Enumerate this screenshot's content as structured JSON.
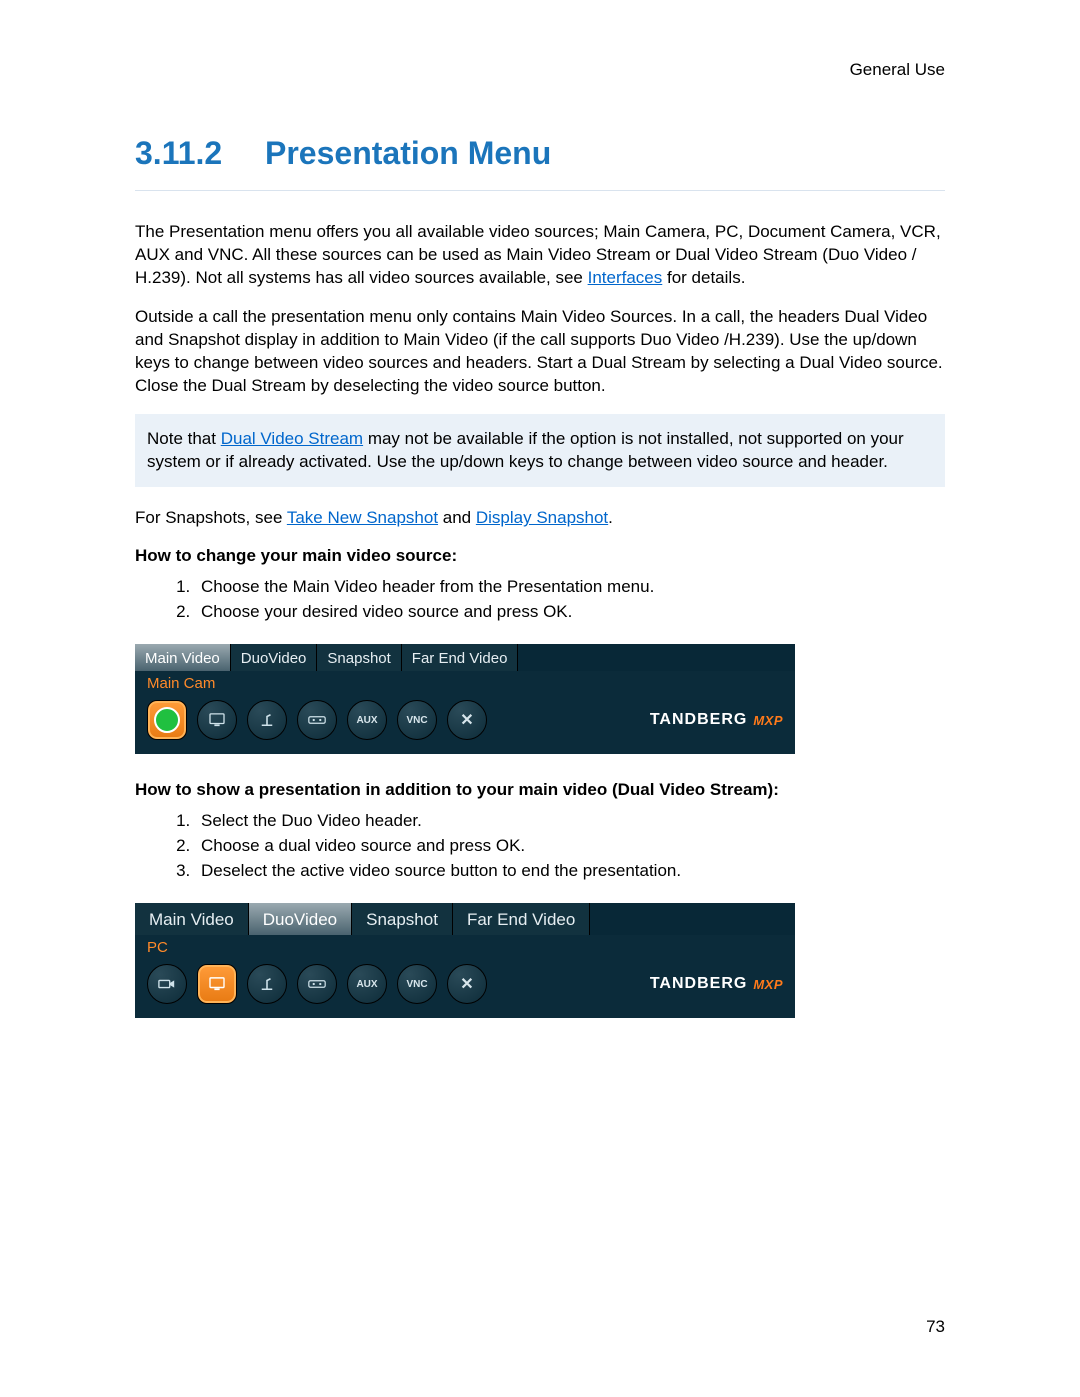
{
  "header": {
    "section": "General Use"
  },
  "heading": {
    "number": "3.11.2",
    "title": "Presentation Menu"
  },
  "para1_a": "The Presentation menu offers you all available video sources; Main Camera, PC, Document Camera, VCR, AUX and VNC. All these sources can be used as Main Video Stream or Dual Video Stream (Duo Video / H.239). Not all systems has all video sources available, see ",
  "para1_link": "Interfaces",
  "para1_b": " for details.",
  "para2": "Outside a call the presentation menu only contains Main Video Sources. In a call, the headers Dual Video and Snapshot display in addition to Main Video (if the call supports Duo Video /H.239). Use the up/down keys to change between video sources and headers. Start a Dual Stream by selecting a Dual Video source. Close the Dual Stream by deselecting the video source button.",
  "note_a": "Note that ",
  "note_link": "Dual Video Stream",
  "note_b": " may not be available if the option is not installed, not supported on your system or if already activated. Use the up/down keys to change between video source and header.",
  "snap_a": "For Snapshots, see ",
  "snap_link1": "Take New Snapshot",
  "snap_mid": " and ",
  "snap_link2": "Display Snapshot",
  "snap_b": ".",
  "sub1": "How to change your main video source:",
  "list1": {
    "i1": "Choose the Main Video header from the Presentation menu.",
    "i2": "Choose your desired video source and press OK."
  },
  "sub2": "How to show a presentation in addition to your main video (Dual Video Stream):",
  "list2": {
    "i1": "Select the Duo Video header.",
    "i2": "Choose a dual video source and press OK.",
    "i3": "Deselect the active video source button to end the presentation."
  },
  "ui1": {
    "tabs": {
      "t1": "Main Video",
      "t2": "DuoVideo",
      "t3": "Snapshot",
      "t4": "Far End Video"
    },
    "selected_label": "Main Cam",
    "icons": {
      "aux": "AUX",
      "vnc": "VNC"
    },
    "brand": "TANDBERG",
    "brand2": "MXP"
  },
  "ui2": {
    "tabs": {
      "t1": "Main Video",
      "t2": "DuoVideo",
      "t3": "Snapshot",
      "t4": "Far End Video"
    },
    "selected_label": "PC",
    "icons": {
      "aux": "AUX",
      "vnc": "VNC"
    },
    "brand": "TANDBERG",
    "brand2": "MXP"
  },
  "page_number": "73"
}
